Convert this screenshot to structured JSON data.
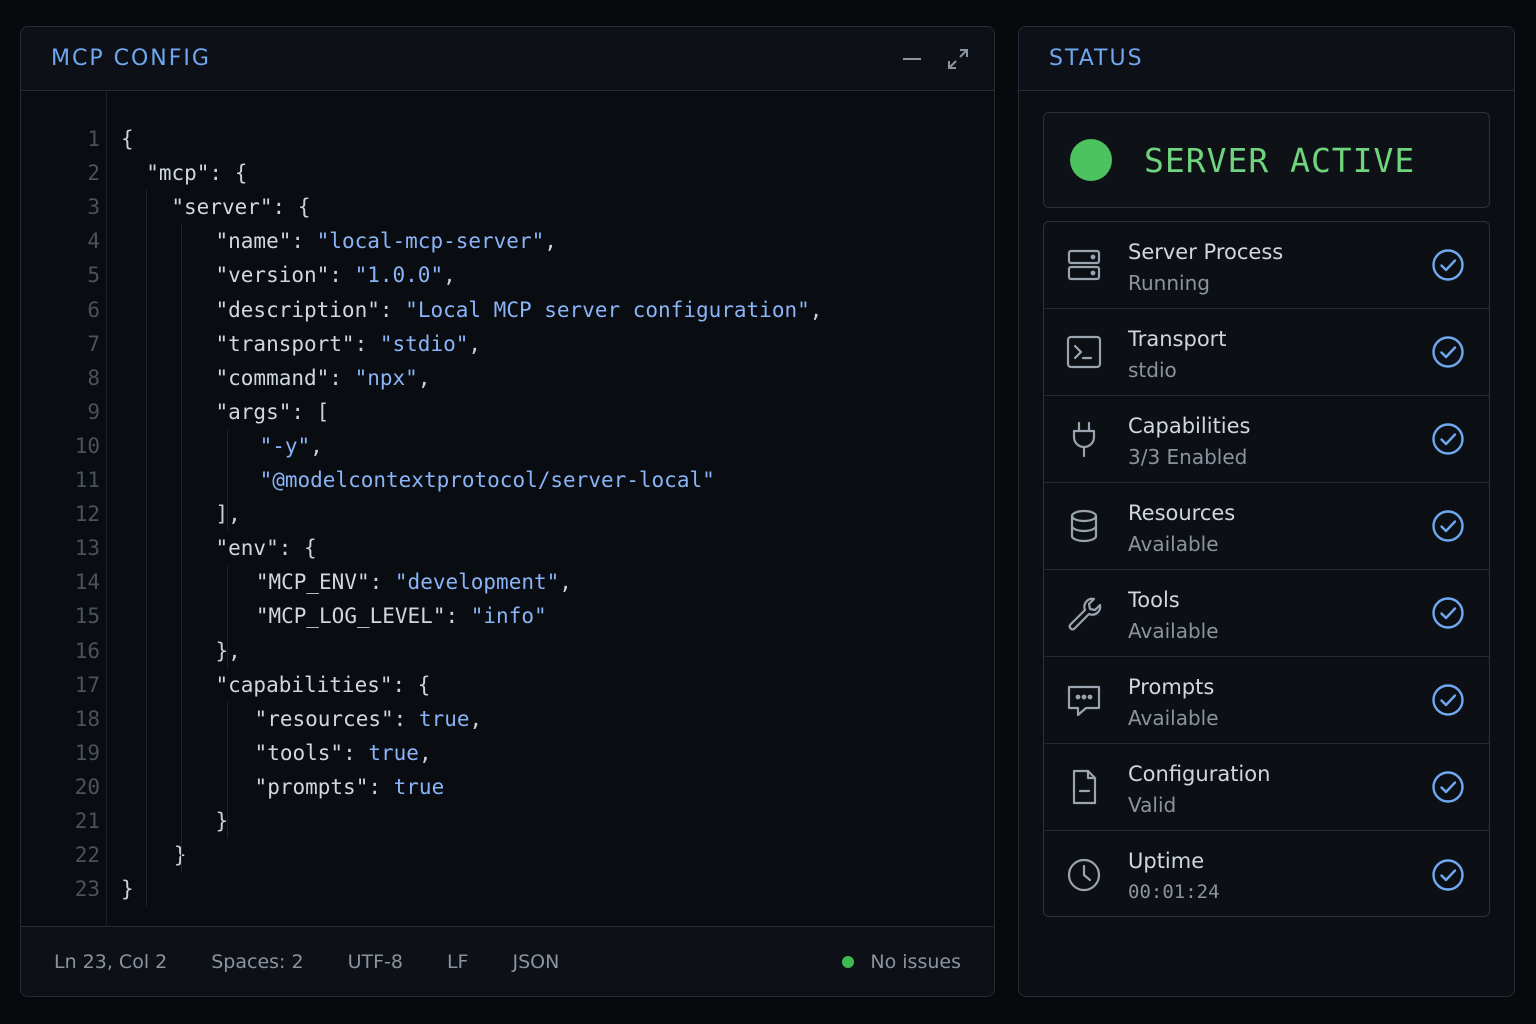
{
  "editor": {
    "title": "MCP CONFIG",
    "line_numbers": [
      "1",
      "2",
      "3",
      "4",
      "5",
      "6",
      "7",
      "8",
      "9",
      "10",
      "11",
      "12",
      "13",
      "14",
      "15",
      "16",
      "17",
      "18",
      "19",
      "20",
      "21",
      "22",
      "23"
    ],
    "lines": [
      [
        {
          "t": "{",
          "c": "punc"
        }
      ],
      [
        {
          "t": "\"mcp\"",
          "c": "key"
        },
        {
          "t": ": {",
          "c": "punc"
        }
      ],
      [
        {
          "t": "\"server\"",
          "c": "key"
        },
        {
          "t": ": {",
          "c": "punc"
        }
      ],
      [
        {
          "t": "\"name\"",
          "c": "key"
        },
        {
          "t": ": ",
          "c": "punc"
        },
        {
          "t": "\"local-mcp-server\"",
          "c": "str"
        },
        {
          "t": ",",
          "c": "punc"
        }
      ],
      [
        {
          "t": "\"version\"",
          "c": "key"
        },
        {
          "t": ": ",
          "c": "punc"
        },
        {
          "t": "\"1.0.0\"",
          "c": "str"
        },
        {
          "t": ",",
          "c": "punc"
        }
      ],
      [
        {
          "t": "\"description\"",
          "c": "key"
        },
        {
          "t": ": ",
          "c": "punc"
        },
        {
          "t": "\"Local MCP server configuration\"",
          "c": "str"
        },
        {
          "t": ",",
          "c": "punc"
        }
      ],
      [
        {
          "t": "\"transport\"",
          "c": "key"
        },
        {
          "t": ": ",
          "c": "punc"
        },
        {
          "t": "\"stdio\"",
          "c": "str"
        },
        {
          "t": ",",
          "c": "punc"
        }
      ],
      [
        {
          "t": "\"command\"",
          "c": "key"
        },
        {
          "t": ": ",
          "c": "punc"
        },
        {
          "t": "\"npx\"",
          "c": "str"
        },
        {
          "t": ",",
          "c": "punc"
        }
      ],
      [
        {
          "t": "\"args\"",
          "c": "key"
        },
        {
          "t": ": [",
          "c": "punc"
        }
      ],
      [
        {
          "t": "\"-y\"",
          "c": "str"
        },
        {
          "t": ",",
          "c": "punc"
        }
      ],
      [
        {
          "t": "\"@modelcontextprotocol/server-local\"",
          "c": "str"
        }
      ],
      [
        {
          "t": "],",
          "c": "punc"
        }
      ],
      [
        {
          "t": "\"env\"",
          "c": "key"
        },
        {
          "t": ": {",
          "c": "punc"
        }
      ],
      [
        {
          "t": "\"MCP_ENV\"",
          "c": "key"
        },
        {
          "t": ": ",
          "c": "punc"
        },
        {
          "t": "\"development\"",
          "c": "str"
        },
        {
          "t": ",",
          "c": "punc"
        }
      ],
      [
        {
          "t": "\"MCP_LOG_LEVEL\"",
          "c": "key"
        },
        {
          "t": ": ",
          "c": "punc"
        },
        {
          "t": "\"info\"",
          "c": "str"
        }
      ],
      [
        {
          "t": "},",
          "c": "punc"
        }
      ],
      [
        {
          "t": "\"capabilities\"",
          "c": "key"
        },
        {
          "t": ": {",
          "c": "punc"
        }
      ],
      [
        {
          "t": "\"resources\"",
          "c": "key"
        },
        {
          "t": ": ",
          "c": "punc"
        },
        {
          "t": "true",
          "c": "bool"
        },
        {
          "t": ",",
          "c": "punc"
        }
      ],
      [
        {
          "t": "\"tools\"",
          "c": "key"
        },
        {
          "t": ": ",
          "c": "punc"
        },
        {
          "t": "true",
          "c": "bool"
        },
        {
          "t": ",",
          "c": "punc"
        }
      ],
      [
        {
          "t": "\"prompts\"",
          "c": "key"
        },
        {
          "t": ": ",
          "c": "punc"
        },
        {
          "t": "true",
          "c": "bool"
        }
      ],
      [
        {
          "t": "}",
          "c": "punc"
        }
      ],
      [
        {
          "t": "}",
          "c": "punc"
        }
      ],
      [
        {
          "t": "}",
          "c": "punc"
        }
      ]
    ]
  },
  "statusbar": {
    "position": "Ln 23,  Col 2",
    "spaces": "Spaces: 2",
    "encoding": "UTF-8",
    "eol": "LF",
    "language": "JSON",
    "issues": "No issues"
  },
  "status": {
    "title": "STATUS",
    "active_label": "SERVER ACTIVE",
    "colors": {
      "accent": "#6fa8f0",
      "active": "#4cc35e",
      "check": "#6fa8f0"
    },
    "checks": [
      {
        "icon": "server-icon",
        "title": "Server Process",
        "sub": "Running"
      },
      {
        "icon": "terminal-icon",
        "title": "Transport",
        "sub": "stdio"
      },
      {
        "icon": "plug-icon",
        "title": "Capabilities",
        "sub": "3/3 Enabled"
      },
      {
        "icon": "database-icon",
        "title": "Resources",
        "sub": "Available"
      },
      {
        "icon": "wrench-icon",
        "title": "Tools",
        "sub": "Available"
      },
      {
        "icon": "message-icon",
        "title": "Prompts",
        "sub": "Available"
      },
      {
        "icon": "file-icon",
        "title": "Configuration",
        "sub": "Valid"
      },
      {
        "icon": "clock-icon",
        "title": "Uptime",
        "sub": "00:01:24"
      }
    ]
  }
}
